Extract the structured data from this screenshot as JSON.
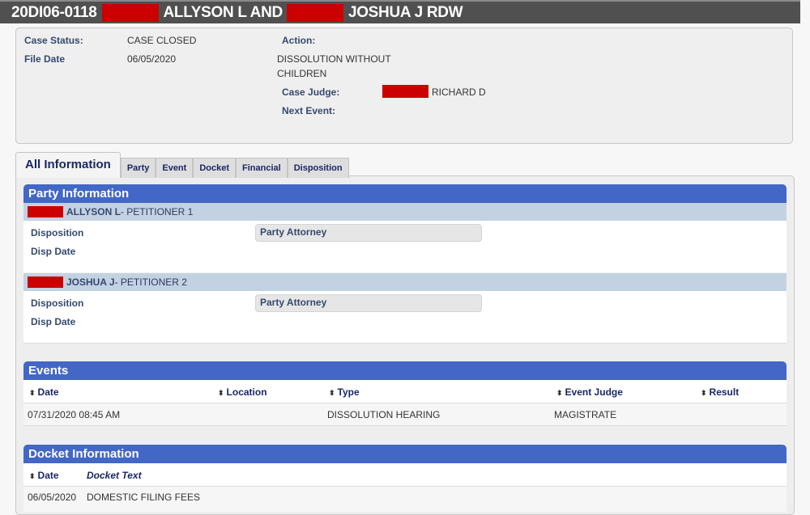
{
  "header": {
    "case_number": "20DI06-0118",
    "party1": "ALLYSON L AND",
    "party2": "JOSHUA J RDW"
  },
  "summary": {
    "case_status_label": "Case Status:",
    "case_status_value": "CASE CLOSED",
    "file_date_label": "File Date",
    "file_date_value": "06/05/2020",
    "action_label": "Action:",
    "action_value_line1": "DISSOLUTION WITHOUT",
    "action_value_line2": "CHILDREN",
    "case_judge_label": "Case Judge:",
    "case_judge_value": "RICHARD D",
    "next_event_label": "Next Event:"
  },
  "tabs": [
    {
      "label": "All Information",
      "active": true
    },
    {
      "label": "Party"
    },
    {
      "label": "Event"
    },
    {
      "label": "Docket"
    },
    {
      "label": "Financial"
    },
    {
      "label": "Disposition"
    }
  ],
  "party_section": {
    "title": "Party Information",
    "parties": [
      {
        "name": "ALLYSON L",
        "role": " - PETITIONER 1",
        "disposition_label": "Disposition",
        "disp_date_label": "Disp Date",
        "attorney_label": "Party Attorney"
      },
      {
        "name": "JOSHUA J",
        "role": " - PETITIONER 2",
        "disposition_label": "Disposition",
        "disp_date_label": "Disp Date",
        "attorney_label": "Party Attorney"
      }
    ]
  },
  "events_section": {
    "title": "Events",
    "columns": [
      "Date",
      "Location",
      "Type",
      "Event Judge",
      "Result"
    ],
    "rows": [
      {
        "date": "07/31/2020 08:45 AM",
        "location": "",
        "type": "DISSOLUTION HEARING",
        "judge": "MAGISTRATE",
        "result": ""
      }
    ]
  },
  "docket_section": {
    "title": "Docket Information",
    "columns": [
      "Date",
      "Docket Text"
    ],
    "rows": [
      {
        "date": "06/05/2020",
        "text": "DOMESTIC FILING FEES"
      }
    ]
  },
  "icons": {
    "sort": "⬍"
  }
}
